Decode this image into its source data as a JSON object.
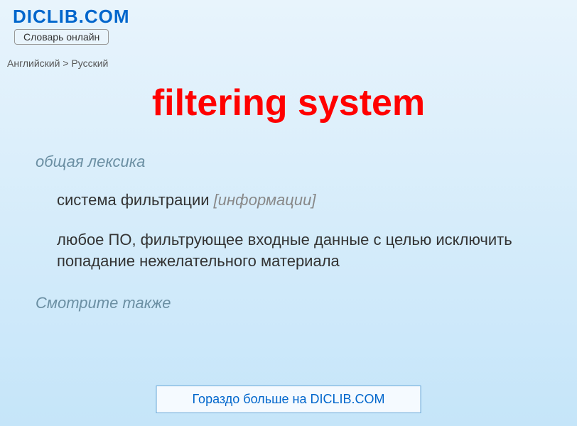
{
  "header": {
    "logo": "DICLIB.COM",
    "subtitle": "Словарь онлайн"
  },
  "breadcrumb": {
    "from": "Английский",
    "separator": ">",
    "to": "Русский"
  },
  "term": "filtering system",
  "category": "общая лексика",
  "definitions": {
    "primary_text": "система фильтрации ",
    "primary_context": "[информации]",
    "secondary": "любое ПО, фильтрующее входные данные с целью исключить попадание нежелательного материала"
  },
  "see_also_label": "Смотрите также",
  "more_link": "Гораздо больше на DICLIB.COM"
}
